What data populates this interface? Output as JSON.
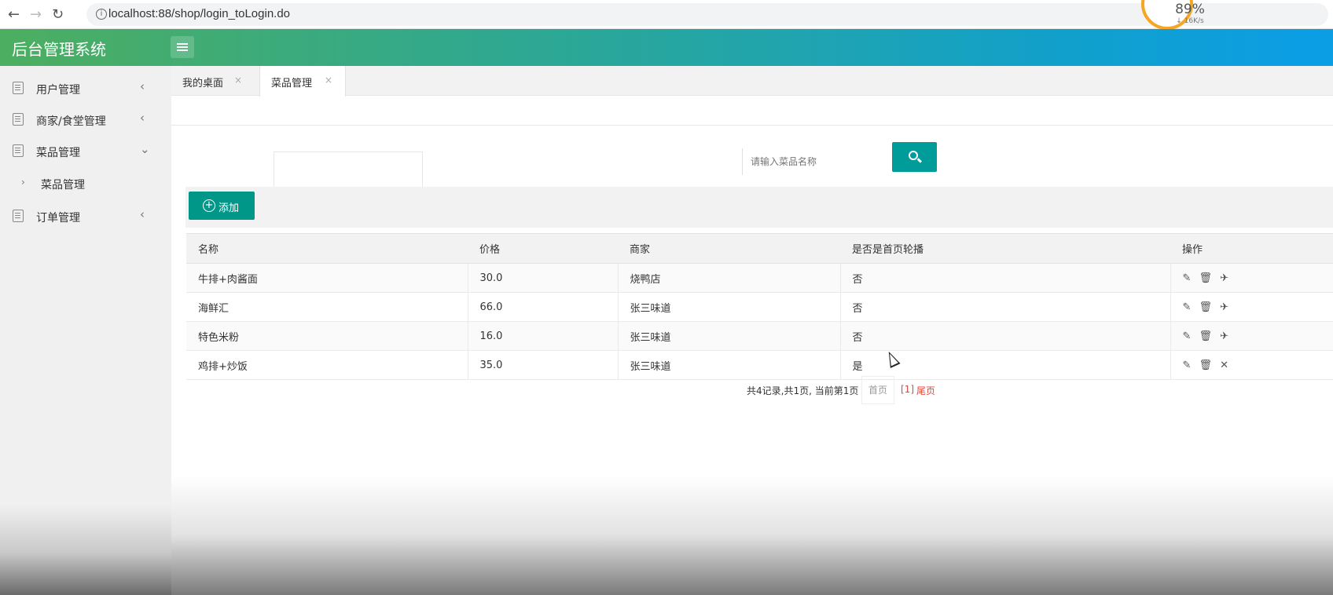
{
  "browser": {
    "url": "localhost:88/shop/login_toLogin.do",
    "speed_percent": "89%",
    "speed_rate": "↓ 16K/s"
  },
  "header": {
    "brand": "后台管理系统"
  },
  "sidebar": {
    "items": [
      {
        "label": "用户管理",
        "arrow": "‹"
      },
      {
        "label": "商家/食堂管理",
        "arrow": "‹"
      },
      {
        "label": "菜品管理",
        "arrow": "⌄"
      },
      {
        "label": "菜品管理",
        "arrow": "›"
      },
      {
        "label": "订单管理",
        "arrow": "‹"
      }
    ]
  },
  "tabs": [
    {
      "label": "我的桌面",
      "close": "×"
    },
    {
      "label": "菜品管理",
      "close": "×"
    }
  ],
  "search": {
    "placeholder": "请输入菜品名称"
  },
  "toolbar": {
    "add_label": "添加"
  },
  "table": {
    "headers": [
      "名称",
      "价格",
      "商家",
      "是否是首页轮播",
      "操作"
    ],
    "rows": [
      [
        "牛排+肉酱面",
        "30.0",
        "烧鸭店",
        "否"
      ],
      [
        "海鲜汇",
        "66.0",
        "张三味道",
        "否"
      ],
      [
        "特色米粉",
        "16.0",
        "张三味道",
        "否"
      ],
      [
        "鸡排+炒饭",
        "35.0",
        "张三味道",
        "是"
      ]
    ],
    "ops_icons": [
      "edit-icon",
      "delete-icon",
      "send-icon"
    ],
    "ops_glyphs": {
      "default": "✎ 🗑 ✈",
      "last": "✎ 🗑 ✕"
    }
  },
  "pager": {
    "info": "共4记录,共1页, 当前第1页",
    "first": "首页",
    "current": "[1]",
    "last": "尾页"
  },
  "colors": {
    "accent": "#009688",
    "header_start": "#4cae60",
    "header_end": "#0b9ee6",
    "pager_active": "#e2473a"
  }
}
